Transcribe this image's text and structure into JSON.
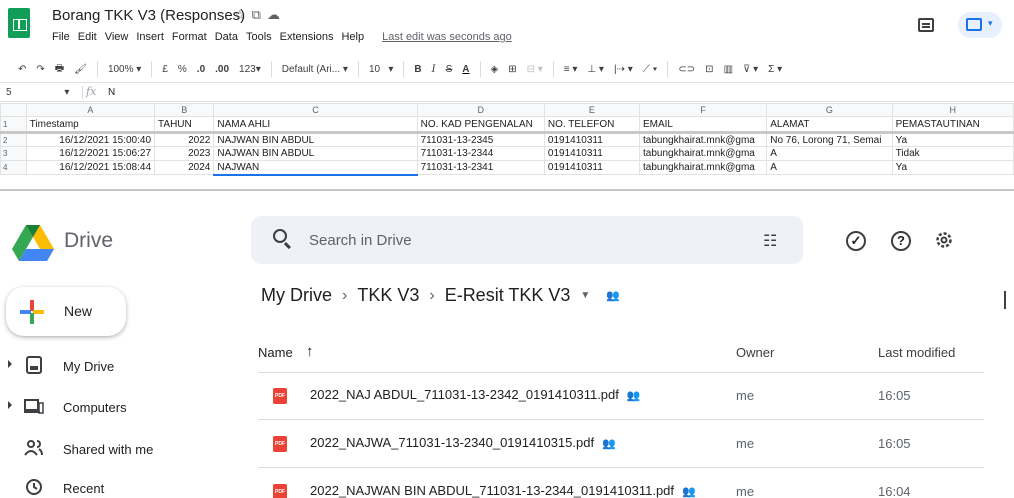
{
  "sheets": {
    "title": "Borang TKK V3 (Responses)",
    "menu": [
      "File",
      "Edit",
      "View",
      "Insert",
      "Format",
      "Data",
      "Tools",
      "Extensions",
      "Help"
    ],
    "last_edit": "Last edit was seconds ago",
    "toolbar": {
      "zoom": "100%",
      "currency": "£",
      "percent": "%",
      "dec_less": ".0",
      "dec_more": ".00",
      "format": "123",
      "font": "Default (Ari...",
      "font_size": "10"
    },
    "formula_bar": {
      "cell_ref": "5",
      "fx": "fx",
      "value": "N"
    },
    "columns": [
      "A",
      "B",
      "C",
      "D",
      "E",
      "F",
      "G",
      "H"
    ],
    "header_row": {
      "row_num": "1",
      "cells": [
        "Timestamp",
        "TAHUN",
        "NAMA AHLI",
        "NO. KAD PENGENALAN",
        "NO. TELEFON",
        "EMAIL",
        "ALAMAT",
        "PEMASTAUTINAN"
      ]
    },
    "rows": [
      {
        "row_num": "2",
        "cells": [
          "16/12/2021 15:00:40",
          "2022",
          "NAJWAN BIN ABDUL",
          "711031-13-2345",
          "0191410311",
          "tabungkhairat.mnk@gma",
          "No 76, Lorong 71, Semai",
          "Ya"
        ]
      },
      {
        "row_num": "3",
        "cells": [
          "16/12/2021 15:06:27",
          "2023",
          "NAJWAN BIN ABDUL",
          "711031-13-2344",
          "0191410311",
          "tabungkhairat.mnk@gma",
          "A",
          "Tidak"
        ]
      },
      {
        "row_num": "4",
        "cells": [
          "16/12/2021 15:08:44",
          "2024",
          "NAJWAN",
          "711031-13-2341",
          "0191410311",
          "tabungkhairat.mnk@gma",
          "A",
          "Ya"
        ]
      }
    ]
  },
  "drive": {
    "app_name": "Drive",
    "search_placeholder": "Search in Drive",
    "new_label": "New",
    "nav": [
      {
        "label": "My Drive",
        "icon": "my-drive-icon"
      },
      {
        "label": "Computers",
        "icon": "computer-icon"
      },
      {
        "label": "Shared with me",
        "icon": "people-icon"
      },
      {
        "label": "Recent",
        "icon": "clock-icon"
      }
    ],
    "breadcrumb": [
      "My Drive",
      "TKK V3",
      "E-Resit TKK V3"
    ],
    "columns": {
      "name": "Name",
      "owner": "Owner",
      "modified": "Last modified"
    },
    "files": [
      {
        "name": "2022_NAJ ABDUL_711031-13-2342_0191410311.pdf",
        "owner": "me",
        "modified": "16:05"
      },
      {
        "name": "2022_NAJWA_711031-13-2340_0191410315.pdf",
        "owner": "me",
        "modified": "16:05"
      },
      {
        "name": "2022_NAJWAN BIN ABDUL_711031-13-2344_0191410311.pdf",
        "owner": "me",
        "modified": "16:04"
      }
    ],
    "colors": {
      "pdf": "#ea4335",
      "search_bg": "#eef2f8"
    }
  }
}
